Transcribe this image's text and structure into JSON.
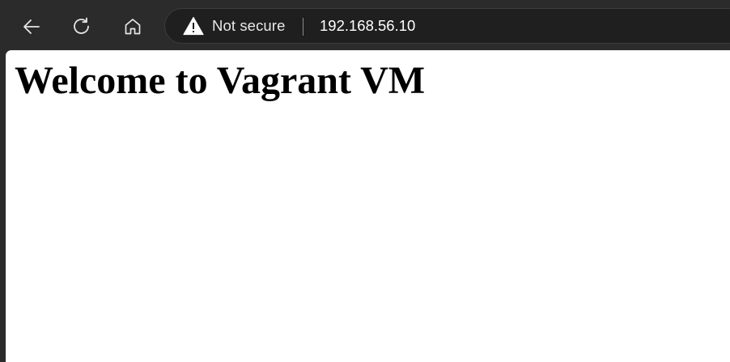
{
  "toolbar": {
    "back_icon": "arrow-left-icon",
    "reload_icon": "reload-icon",
    "home_icon": "home-icon"
  },
  "address_bar": {
    "security_icon": "warning-triangle-icon",
    "security_label": "Not secure",
    "url": "192.168.56.10"
  },
  "page": {
    "heading": "Welcome to Vagrant VM"
  },
  "colors": {
    "chrome_background": "#2b2b2b",
    "address_bar_background": "#1f1f1f",
    "page_background": "#ffffff",
    "text_light": "#e8e8e8"
  }
}
